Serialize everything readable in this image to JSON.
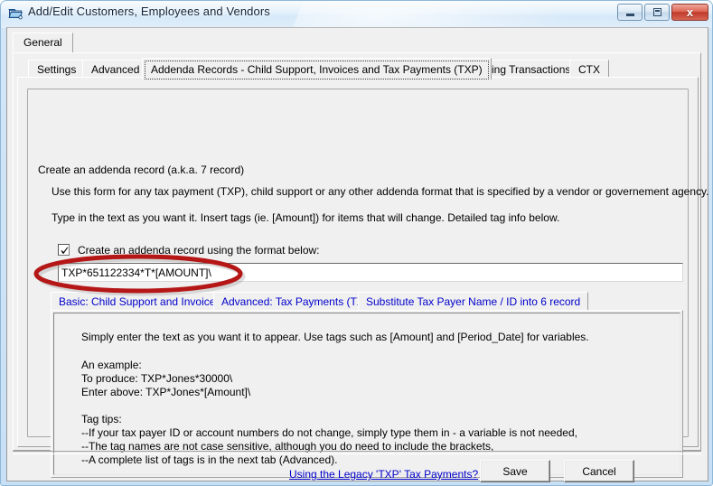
{
  "window": {
    "title": "Add/Edit Customers, Employees and Vendors",
    "icon": "window-folder-icon",
    "controls": {
      "minimize": "minimize-icon",
      "maximize": "maximize-icon",
      "close": "x"
    }
  },
  "outer_tabs": [
    {
      "label": "General",
      "selected": true
    }
  ],
  "main_tabs": [
    {
      "label": "Settings",
      "selected": false
    },
    {
      "label": "Advanced",
      "selected": false
    },
    {
      "label": "Addenda Records - Child Support, Invoices and Tax Payments (TXP)",
      "selected": true
    },
    {
      "label": "Recurring Transactions",
      "selected": false
    },
    {
      "label": "CTX",
      "selected": false
    }
  ],
  "groupbox": {
    "label": "Create an addenda record (a.k.a. 7 record)",
    "line1": "Use this form for any tax payment (TXP), child support or any other addenda format that is specified by a vendor or governement agency.",
    "line2": "Type in the text as you want it.  Insert tags (ie. [Amount]) for items that will change. Detailed tag info below."
  },
  "checkbox": {
    "label": "Create an addenda record using the format below:",
    "checked": true
  },
  "format_field": {
    "value": "TXP*651122334*T*[AMOUNT]\\",
    "placeholder": ""
  },
  "annotation": {
    "shape": "ellipse",
    "color": "#b51717"
  },
  "sub_tabs": [
    {
      "label": "Basic: Child Support and Invoices",
      "selected": true
    },
    {
      "label": "Advanced: Tax Payments (TXP)",
      "selected": false
    },
    {
      "label": "Substitute Tax Payer Name / ID into 6 record",
      "selected": false
    }
  ],
  "sub_panel": {
    "intro": "Simply enter the text as you want it to appear.  Use tags such as [Amount] and [Period_Date] for variables.",
    "example_heading": "An example:",
    "example_produce": "To produce: TXP*Jones*30000\\",
    "example_enter": "Enter above: TXP*Jones*[Amount]\\",
    "tips_heading": "Tag tips:",
    "tip1": "--If your tax payer ID or account numbers do not change, simply type them in - a variable is not needed,",
    "tip2": "--The tag names are not case sensitive, although you do need to include the brackets,",
    "tip3": "--A complete list of tags is in the next tab (Advanced)."
  },
  "footer": {
    "legacy_link": "Using the Legacy 'TXP' Tax Payments?",
    "save_label": "Save",
    "cancel_label": "Cancel"
  },
  "colors": {
    "link": "#0000cc",
    "annotation": "#b51717",
    "titlebar": "#cfe4f7",
    "client": "#f0f0f0"
  }
}
